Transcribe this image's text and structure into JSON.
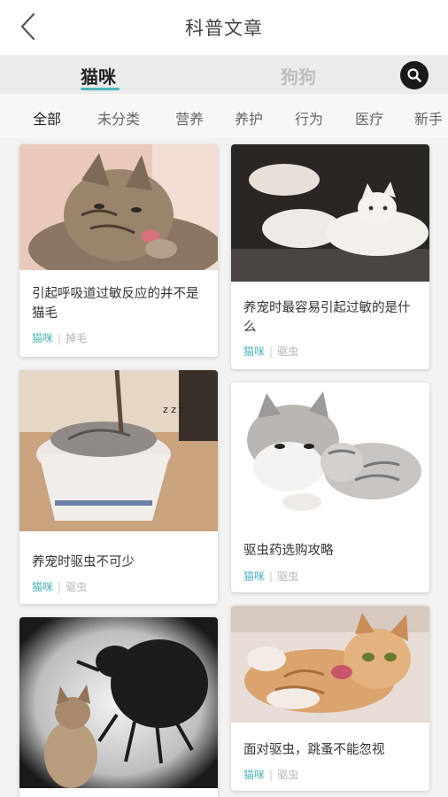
{
  "header": {
    "title": "科普文章"
  },
  "tabs": {
    "active": "猫咪",
    "inactive": "狗狗"
  },
  "categories": [
    "全部",
    "未分类",
    "营养",
    "养护",
    "行为",
    "医疗",
    "新手"
  ],
  "articles": [
    {
      "title": "引起呼吸道过敏反应的并不是猫毛",
      "tag1": "猫咪",
      "tag2": "掉毛"
    },
    {
      "title": "养宠时最容易引起过敏的是什么",
      "tag1": "猫咪",
      "tag2": "驱虫"
    },
    {
      "title": "养宠时驱虫不可少",
      "tag1": "猫咪",
      "tag2": "驱虫"
    },
    {
      "title": "驱虫药选购攻略",
      "tag1": "猫咪",
      "tag2": "驱虫"
    },
    {
      "title": "",
      "tag1": "",
      "tag2": ""
    },
    {
      "title": "面对驱虫，跳蚤不能忽视",
      "tag1": "猫咪",
      "tag2": "驱虫"
    }
  ],
  "colors": {
    "accent": "#4bb3b9",
    "tabbar_bg": "#ebebeb"
  },
  "icons": {
    "back": "back-arrow-icon",
    "search": "search-icon"
  }
}
